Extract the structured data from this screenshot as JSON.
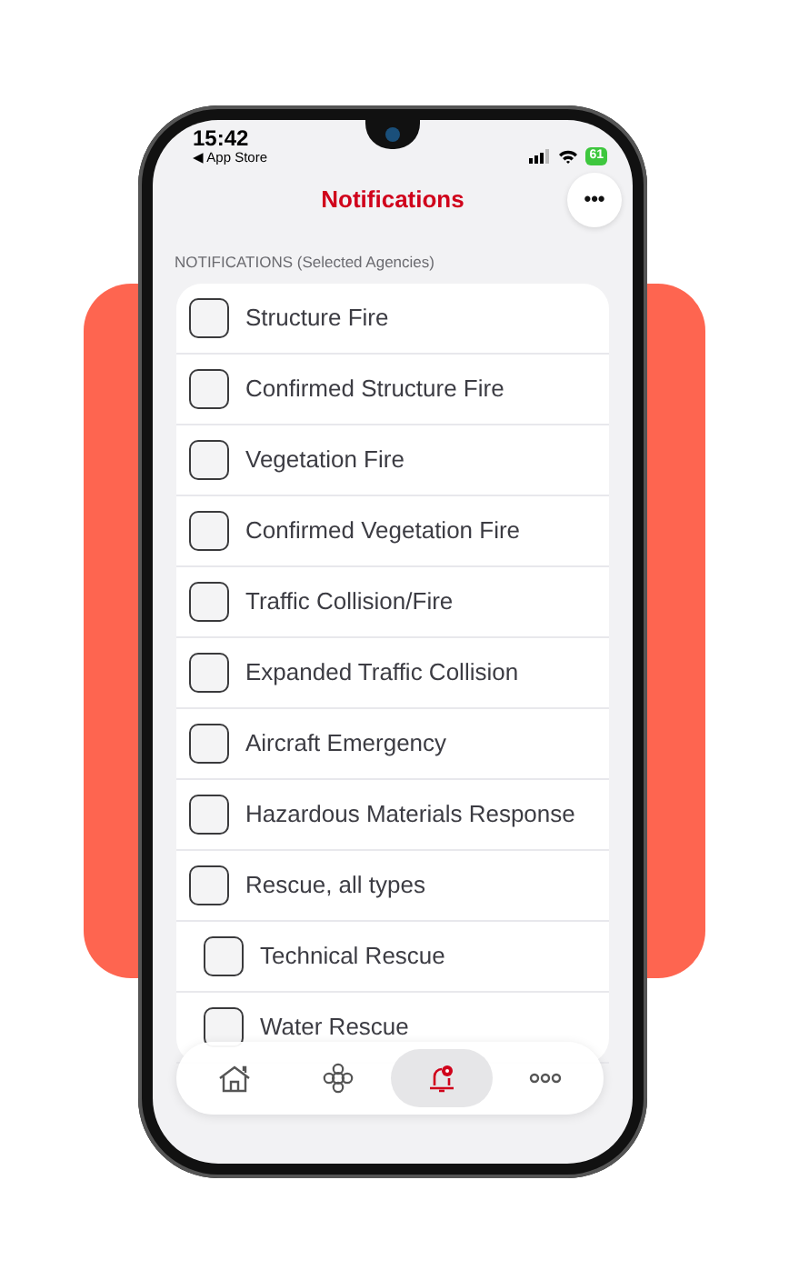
{
  "status_bar": {
    "time": "15:42",
    "back_label": "◀ App Store",
    "battery": "61"
  },
  "header": {
    "title": "Notifications",
    "more_label": "•••"
  },
  "section": {
    "label": "NOTIFICATIONS (Selected Agencies)"
  },
  "options": [
    {
      "label": "Structure Fire",
      "checked": false
    },
    {
      "label": "Confirmed Structure Fire",
      "checked": false
    },
    {
      "label": "Vegetation Fire",
      "checked": false
    },
    {
      "label": "Confirmed Vegetation Fire",
      "checked": false
    },
    {
      "label": "Traffic Collision/Fire",
      "checked": false
    },
    {
      "label": "Expanded Traffic Collision",
      "checked": false
    },
    {
      "label": "Aircraft Emergency",
      "checked": false
    },
    {
      "label": "Hazardous Materials Response",
      "checked": false
    },
    {
      "label": "Rescue, all types",
      "checked": false,
      "children": [
        {
          "label": "Technical Rescue",
          "checked": false
        },
        {
          "label": "Water Rescue",
          "checked": false
        }
      ]
    }
  ],
  "tab_bar": [
    {
      "kind": "home",
      "selected": false
    },
    {
      "kind": "agency",
      "selected": false
    },
    {
      "kind": "alerts",
      "selected": true
    },
    {
      "kind": "more",
      "selected": false
    }
  ]
}
